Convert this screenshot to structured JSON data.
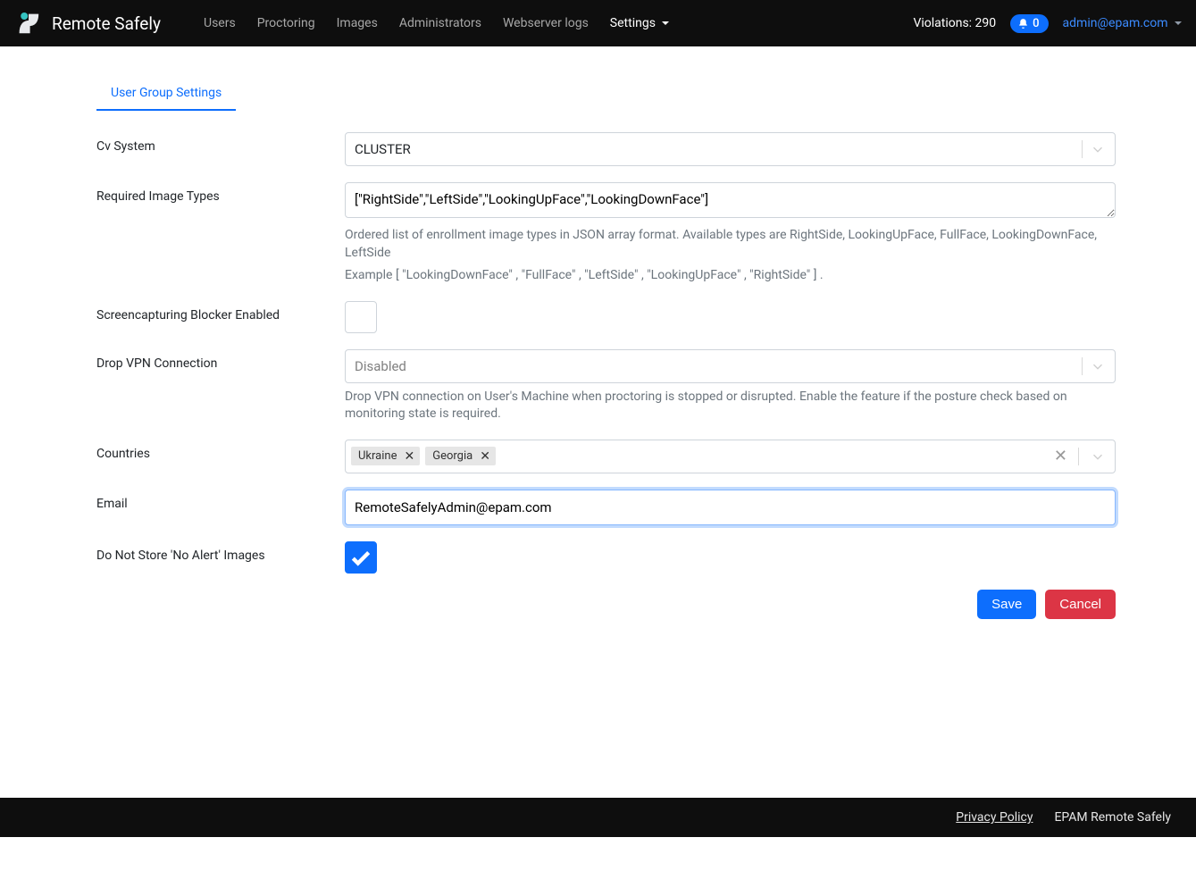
{
  "header": {
    "app_title": "Remote Safely",
    "nav": {
      "users": "Users",
      "proctoring": "Proctoring",
      "images": "Images",
      "administrators": "Administrators",
      "logs": "Webserver logs",
      "settings": "Settings"
    },
    "violations_label": "Violations: 290",
    "notifications_count": "0",
    "user_email": "admin@epam.com"
  },
  "tab": {
    "user_group_settings": "User Group Settings"
  },
  "form": {
    "cv_system": {
      "label": "Cv System",
      "value": "CLUSTER"
    },
    "required_image_types": {
      "label": "Required Image Types",
      "value": "[\"RightSide\",\"LeftSide\",\"LookingUpFace\",\"LookingDownFace\"]",
      "help1": "Ordered list of enrollment image types in JSON array format. Available types are RightSide, LookingUpFace, FullFace, LookingDownFace, LeftSide",
      "help2": "Example [ \"LookingDownFace\" , \"FullFace\" , \"LeftSide\" , \"LookingUpFace\" , \"RightSide\" ] ."
    },
    "screencapturing_blocker": {
      "label": "Screencapturing Blocker Enabled"
    },
    "drop_vpn": {
      "label": "Drop VPN Connection",
      "value": "Disabled",
      "help": "Drop VPN connection on User's Machine when proctoring is stopped or disrupted. Enable the feature if the posture check based on monitoring state is required."
    },
    "countries": {
      "label": "Countries",
      "tags": [
        "Ukraine",
        "Georgia"
      ]
    },
    "email": {
      "label": "Email",
      "value": "RemoteSafelyAdmin@epam.com"
    },
    "do_not_store": {
      "label": "Do Not Store 'No Alert' Images"
    }
  },
  "actions": {
    "save": "Save",
    "cancel": "Cancel"
  },
  "footer": {
    "privacy": "Privacy Policy",
    "brand": "EPAM Remote Safely"
  }
}
